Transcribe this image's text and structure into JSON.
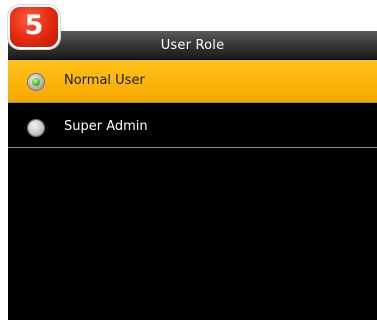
{
  "step_badge": "5",
  "header": {
    "title": "User Role"
  },
  "options": [
    {
      "label": "Normal User",
      "selected": true
    },
    {
      "label": "Super Admin",
      "selected": false
    }
  ],
  "colors": {
    "selected_row": "#f7a800",
    "screen_background": "#000000",
    "badge": "#e02a10",
    "radio_selected_dot": "#3dbb1c"
  }
}
